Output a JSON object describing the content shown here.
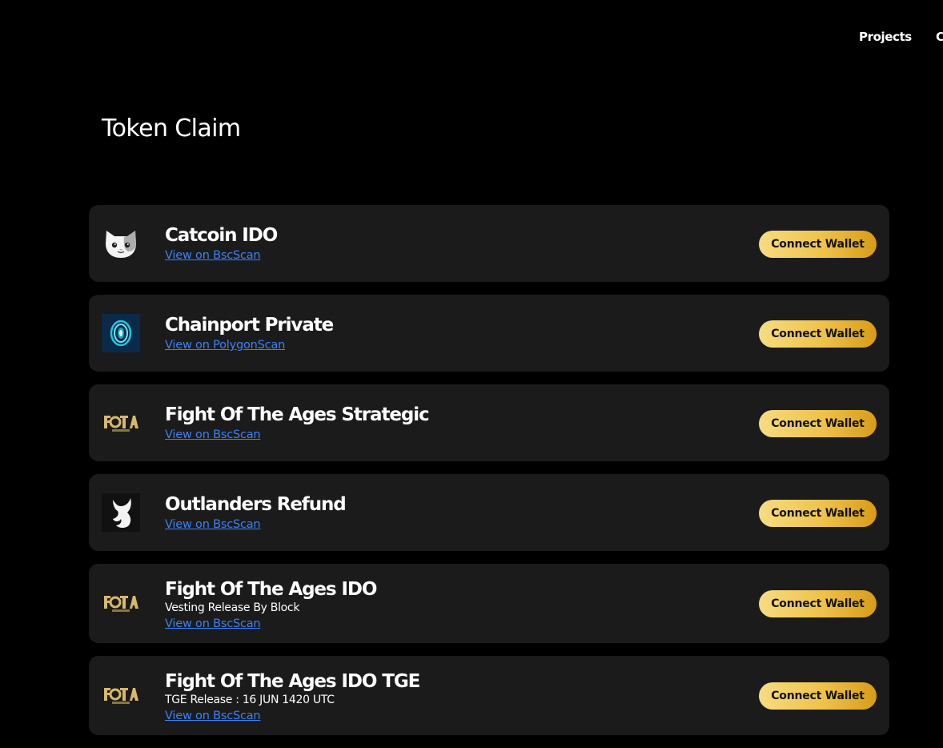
{
  "nav": {
    "projects_label": "Projects",
    "next_label": "C"
  },
  "page": {
    "title": "Token Claim"
  },
  "colors": {
    "background": "#000000",
    "card": "#1b1b1b",
    "link": "#3b82f6",
    "button_gold_start": "#f7dc80",
    "button_gold_end": "#d79c18"
  },
  "projects": [
    {
      "name": "Catcoin IDO",
      "subtitle": "",
      "link_label": "View on BscScan",
      "button_label": "Connect Wallet",
      "logo": "cat-face-icon"
    },
    {
      "name": "Chainport Private",
      "subtitle": "",
      "link_label": "View on PolygonScan",
      "button_label": "Connect Wallet",
      "logo": "chainport-portal-icon"
    },
    {
      "name": "Fight Of The Ages Strategic",
      "subtitle": "",
      "link_label": "View on BscScan",
      "button_label": "Connect Wallet",
      "logo": "fota-logo-icon"
    },
    {
      "name": "Outlanders Refund",
      "subtitle": "",
      "link_label": "View on BscScan",
      "button_label": "Connect Wallet",
      "logo": "bull-head-icon"
    },
    {
      "name": "Fight Of The Ages IDO",
      "subtitle": "Vesting Release By Block",
      "link_label": "View on BscScan",
      "button_label": "Connect Wallet",
      "logo": "fota-logo-icon"
    },
    {
      "name": "Fight Of The Ages IDO TGE",
      "subtitle": "TGE Release : 16 JUN 1420 UTC",
      "link_label": "View on BscScan",
      "button_label": "Connect Wallet",
      "logo": "fota-logo-icon"
    }
  ]
}
